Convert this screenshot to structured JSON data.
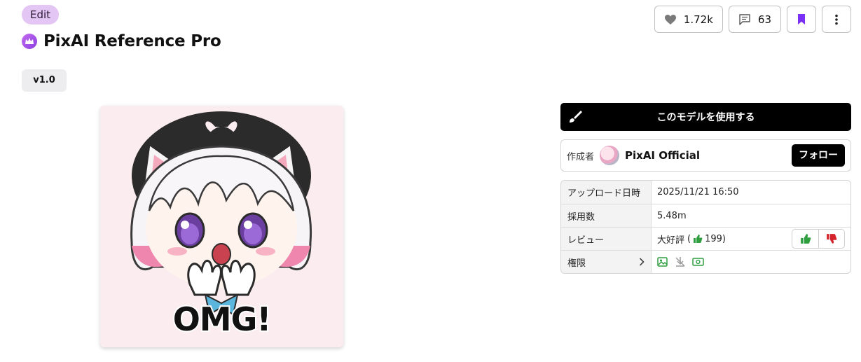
{
  "header": {
    "edit_label": "Edit",
    "title": "PixAI Reference Pro",
    "crown_icon": "crown-icon",
    "version": "v1.0"
  },
  "actions": {
    "likes": "1.72k",
    "comments": "63",
    "bookmark_color": "#7b2ff7"
  },
  "preview": {
    "caption": "OMG!"
  },
  "sidebar": {
    "use_button_label": "このモデルを使用する",
    "author_caption": "作成者",
    "author_name": "PixAI Official",
    "follow_label": "フォロー",
    "rows": {
      "upload_key": "アップロード日時",
      "upload_val": "2025/11/21 16:50",
      "usage_key": "採用数",
      "usage_val": "5.48m",
      "review_key": "レビュー",
      "review_text": "大好評",
      "review_count": "199",
      "perm_key": "権限"
    },
    "colors": {
      "thumb_up": "#2e9e3f",
      "thumb_down": "#d4232a"
    }
  }
}
